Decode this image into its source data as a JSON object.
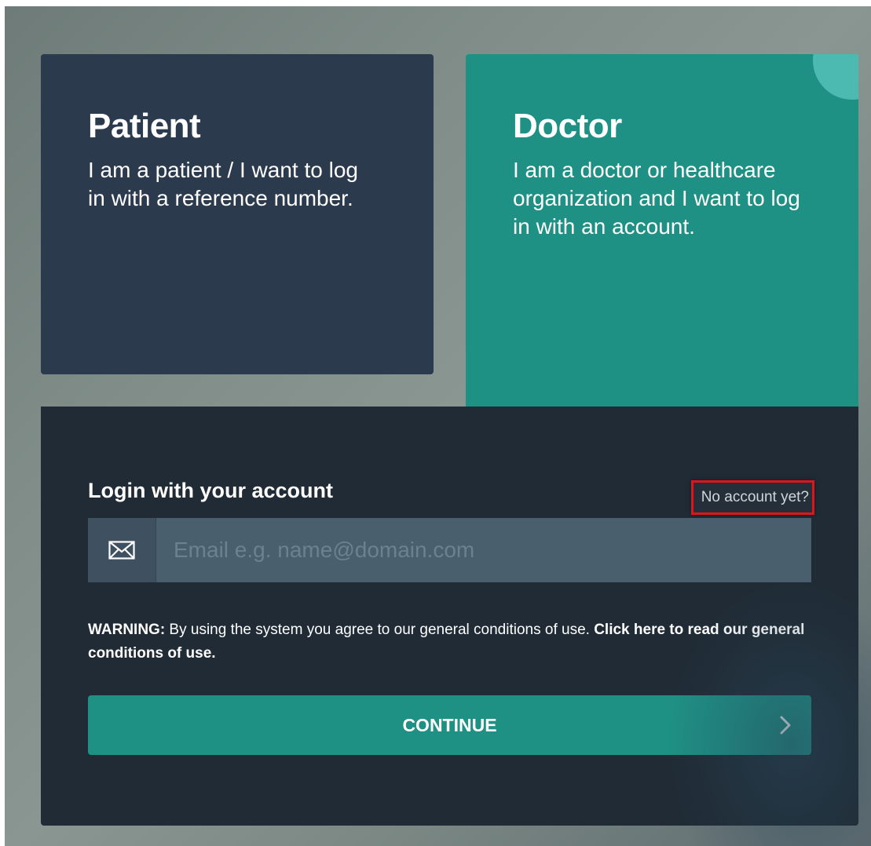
{
  "patient_card": {
    "title": "Patient",
    "description": "I am a patient / I want to log in with a reference number."
  },
  "doctor_card": {
    "title": "Doctor",
    "description": "I am a doctor or healthcare organization and I want to log in with an account."
  },
  "login": {
    "heading": "Login with your account",
    "no_account_link": "No account yet?",
    "email_placeholder": "Email e.g. name@domain.com",
    "email_value": "",
    "email_icon": "envelope-icon",
    "warning_label": "WARNING:",
    "warning_text": " By using the system you agree to our general conditions of use. ",
    "warning_link": "Click here to read our general conditions of use.",
    "continue_label": "CONTINUE",
    "continue_icon": "chevron-right-icon"
  },
  "colors": {
    "patient_bg": "#2c3a4e",
    "doctor_bg": "#1f9084",
    "panel_bg": "#202b35",
    "accent": "#1f9084",
    "highlight": "#e0141b"
  }
}
